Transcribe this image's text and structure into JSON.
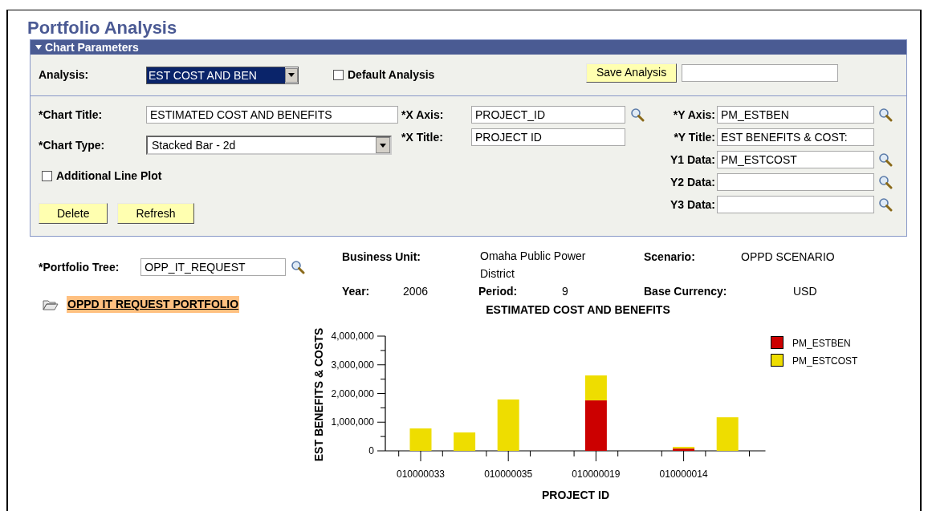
{
  "page_title": "Portfolio Analysis",
  "chart_parameters": {
    "header": "Chart Parameters",
    "expanded": true,
    "analysis": {
      "label": "Analysis:",
      "value": "EST COST AND BEN"
    },
    "default_analysis": {
      "label": "Default Analysis",
      "checked": false
    },
    "save_button": "Save Analysis",
    "left_fields": [
      {
        "kind": "text",
        "label": "*Chart Title:",
        "value": "ESTIMATED COST AND BENEFITS"
      },
      {
        "kind": "dropdown",
        "label": "*Chart Type:",
        "value": "Stacked Bar - 2d"
      }
    ],
    "additional_line_plot": {
      "label": "Additional Line Plot",
      "checked": false
    },
    "buttons": [
      "Delete",
      "Refresh"
    ],
    "x_fields": [
      {
        "label": "*X Axis:",
        "value": "PROJECT_ID",
        "lookup": true
      },
      {
        "label": "*X Title:",
        "value": "PROJECT ID",
        "lookup": false
      }
    ],
    "y_fields": [
      {
        "label": "*Y Axis:",
        "value": "PM_ESTBEN",
        "lookup": true
      },
      {
        "label": "*Y Title:",
        "value": "EST BENEFITS & COST:",
        "lookup": false
      },
      {
        "label": "Y1 Data:",
        "value": "PM_ESTCOST",
        "lookup": true
      },
      {
        "label": "Y2 Data:",
        "lookup": true
      },
      {
        "label": "Y3 Data:",
        "lookup": true
      }
    ]
  },
  "portfolio_tree": {
    "label": "*Portfolio Tree:",
    "value": "OPP_IT_REQUEST"
  },
  "tree_node": {
    "label": "OPPD IT REQUEST PORTFOLIO",
    "selected": true
  },
  "summary": [
    [
      {
        "label": "Business Unit:",
        "value": "Omaha Public Power District"
      },
      {
        "label": "Scenario:",
        "value": "OPPD SCENARIO"
      }
    ],
    [
      {
        "label": "Year:",
        "value": "2006"
      },
      {
        "label": "Period:",
        "value": "9"
      },
      {
        "label": "Base Currency:",
        "value": "USD"
      }
    ]
  ],
  "chart": {
    "chart_data": {
      "type": "bar",
      "stacked": true,
      "title": "ESTIMATED COST AND BENEFITS",
      "xlabel": "PROJECT ID",
      "ylabel": "EST BENEFITS & COSTS",
      "categories": [
        "010000033",
        null,
        "010000035",
        null,
        "010000019",
        null,
        "010000014",
        null
      ],
      "legend": "right",
      "ylim": [
        0,
        4000000
      ],
      "yticks": [
        {
          "value": 0,
          "label": "0"
        },
        {
          "value": 1000000,
          "label": "1,000,000"
        },
        {
          "value": 2000000,
          "label": "2,000,000"
        },
        {
          "value": 3000000,
          "label": "3,000,000"
        },
        {
          "value": 4000000,
          "label": "4,000,000"
        }
      ],
      "series": [
        {
          "name": "PM_ESTBEN",
          "color": "#cc0000",
          "values": [
            0,
            0,
            0,
            0,
            1760000,
            0,
            80000,
            0
          ]
        },
        {
          "name": "PM_ESTCOST",
          "color": "#eedd00",
          "values": [
            780000,
            640000,
            1790000,
            0,
            870000,
            0,
            60000,
            1170000
          ]
        }
      ]
    }
  }
}
